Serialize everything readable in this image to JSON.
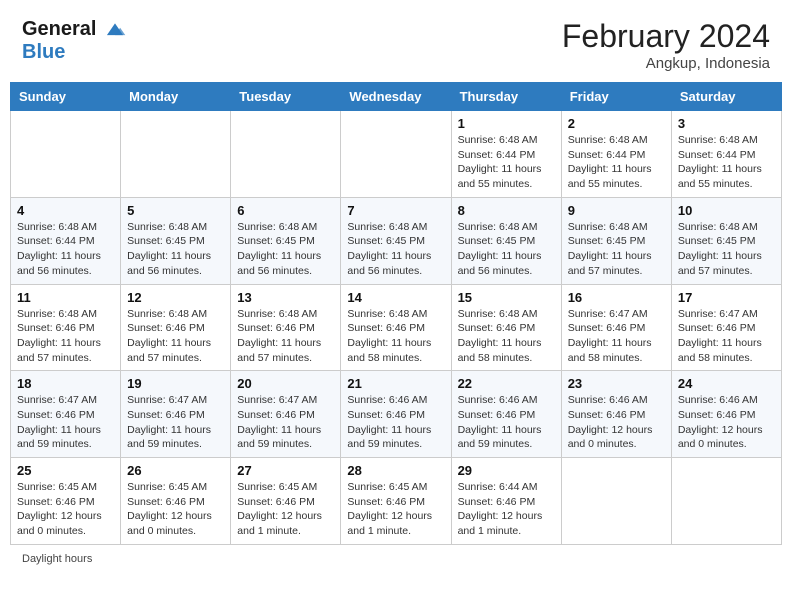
{
  "header": {
    "logo_line1": "General",
    "logo_line2": "Blue",
    "month_year": "February 2024",
    "location": "Angkup, Indonesia"
  },
  "days_of_week": [
    "Sunday",
    "Monday",
    "Tuesday",
    "Wednesday",
    "Thursday",
    "Friday",
    "Saturday"
  ],
  "weeks": [
    [
      {
        "day": "",
        "info": ""
      },
      {
        "day": "",
        "info": ""
      },
      {
        "day": "",
        "info": ""
      },
      {
        "day": "",
        "info": ""
      },
      {
        "day": "1",
        "info": "Sunrise: 6:48 AM\nSunset: 6:44 PM\nDaylight: 11 hours\nand 55 minutes."
      },
      {
        "day": "2",
        "info": "Sunrise: 6:48 AM\nSunset: 6:44 PM\nDaylight: 11 hours\nand 55 minutes."
      },
      {
        "day": "3",
        "info": "Sunrise: 6:48 AM\nSunset: 6:44 PM\nDaylight: 11 hours\nand 55 minutes."
      }
    ],
    [
      {
        "day": "4",
        "info": "Sunrise: 6:48 AM\nSunset: 6:44 PM\nDaylight: 11 hours\nand 56 minutes."
      },
      {
        "day": "5",
        "info": "Sunrise: 6:48 AM\nSunset: 6:45 PM\nDaylight: 11 hours\nand 56 minutes."
      },
      {
        "day": "6",
        "info": "Sunrise: 6:48 AM\nSunset: 6:45 PM\nDaylight: 11 hours\nand 56 minutes."
      },
      {
        "day": "7",
        "info": "Sunrise: 6:48 AM\nSunset: 6:45 PM\nDaylight: 11 hours\nand 56 minutes."
      },
      {
        "day": "8",
        "info": "Sunrise: 6:48 AM\nSunset: 6:45 PM\nDaylight: 11 hours\nand 56 minutes."
      },
      {
        "day": "9",
        "info": "Sunrise: 6:48 AM\nSunset: 6:45 PM\nDaylight: 11 hours\nand 57 minutes."
      },
      {
        "day": "10",
        "info": "Sunrise: 6:48 AM\nSunset: 6:45 PM\nDaylight: 11 hours\nand 57 minutes."
      }
    ],
    [
      {
        "day": "11",
        "info": "Sunrise: 6:48 AM\nSunset: 6:46 PM\nDaylight: 11 hours\nand 57 minutes."
      },
      {
        "day": "12",
        "info": "Sunrise: 6:48 AM\nSunset: 6:46 PM\nDaylight: 11 hours\nand 57 minutes."
      },
      {
        "day": "13",
        "info": "Sunrise: 6:48 AM\nSunset: 6:46 PM\nDaylight: 11 hours\nand 57 minutes."
      },
      {
        "day": "14",
        "info": "Sunrise: 6:48 AM\nSunset: 6:46 PM\nDaylight: 11 hours\nand 58 minutes."
      },
      {
        "day": "15",
        "info": "Sunrise: 6:48 AM\nSunset: 6:46 PM\nDaylight: 11 hours\nand 58 minutes."
      },
      {
        "day": "16",
        "info": "Sunrise: 6:47 AM\nSunset: 6:46 PM\nDaylight: 11 hours\nand 58 minutes."
      },
      {
        "day": "17",
        "info": "Sunrise: 6:47 AM\nSunset: 6:46 PM\nDaylight: 11 hours\nand 58 minutes."
      }
    ],
    [
      {
        "day": "18",
        "info": "Sunrise: 6:47 AM\nSunset: 6:46 PM\nDaylight: 11 hours\nand 59 minutes."
      },
      {
        "day": "19",
        "info": "Sunrise: 6:47 AM\nSunset: 6:46 PM\nDaylight: 11 hours\nand 59 minutes."
      },
      {
        "day": "20",
        "info": "Sunrise: 6:47 AM\nSunset: 6:46 PM\nDaylight: 11 hours\nand 59 minutes."
      },
      {
        "day": "21",
        "info": "Sunrise: 6:46 AM\nSunset: 6:46 PM\nDaylight: 11 hours\nand 59 minutes."
      },
      {
        "day": "22",
        "info": "Sunrise: 6:46 AM\nSunset: 6:46 PM\nDaylight: 11 hours\nand 59 minutes."
      },
      {
        "day": "23",
        "info": "Sunrise: 6:46 AM\nSunset: 6:46 PM\nDaylight: 12 hours\nand 0 minutes."
      },
      {
        "day": "24",
        "info": "Sunrise: 6:46 AM\nSunset: 6:46 PM\nDaylight: 12 hours\nand 0 minutes."
      }
    ],
    [
      {
        "day": "25",
        "info": "Sunrise: 6:45 AM\nSunset: 6:46 PM\nDaylight: 12 hours\nand 0 minutes."
      },
      {
        "day": "26",
        "info": "Sunrise: 6:45 AM\nSunset: 6:46 PM\nDaylight: 12 hours\nand 0 minutes."
      },
      {
        "day": "27",
        "info": "Sunrise: 6:45 AM\nSunset: 6:46 PM\nDaylight: 12 hours\nand 1 minute."
      },
      {
        "day": "28",
        "info": "Sunrise: 6:45 AM\nSunset: 6:46 PM\nDaylight: 12 hours\nand 1 minute."
      },
      {
        "day": "29",
        "info": "Sunrise: 6:44 AM\nSunset: 6:46 PM\nDaylight: 12 hours\nand 1 minute."
      },
      {
        "day": "",
        "info": ""
      },
      {
        "day": "",
        "info": ""
      }
    ]
  ],
  "footer": {
    "daylight_label": "Daylight hours"
  }
}
